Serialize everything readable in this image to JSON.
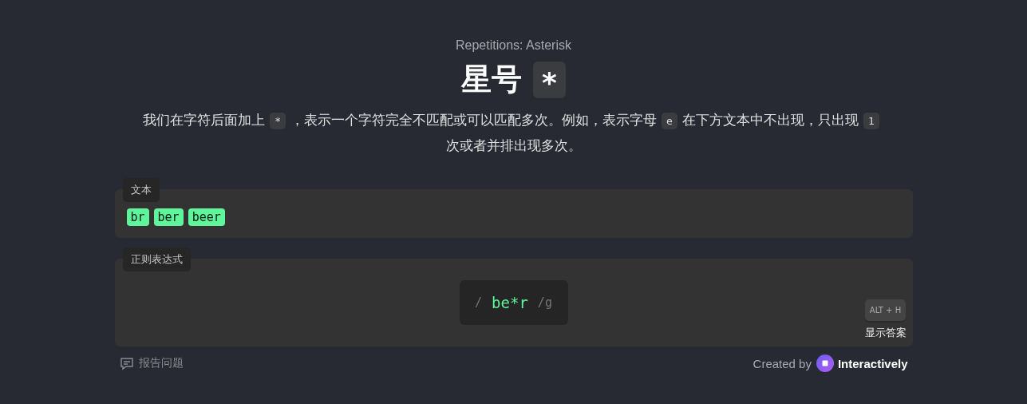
{
  "subtitle": "Repetitions: Asterisk",
  "heading": {
    "text": "星号",
    "symbol": "*"
  },
  "description": [
    {
      "kind": "text",
      "text": "我们在字符后面加上"
    },
    {
      "kind": "code",
      "text": "*"
    },
    {
      "kind": "text",
      "text": "，表示一个字符完全不匹配或可以匹配多次。例如，表示字母"
    },
    {
      "kind": "code",
      "text": "e"
    },
    {
      "kind": "text",
      "text": "在下方文本中不出现，"
    },
    {
      "kind": "text",
      "text": "只出现"
    },
    {
      "kind": "code",
      "text": "1"
    },
    {
      "kind": "text",
      "text": "次或者并排出现多次。"
    }
  ],
  "text_panel": {
    "label": "文本",
    "words": [
      {
        "text": "br",
        "matched": true
      },
      {
        "text": "ber",
        "matched": true
      },
      {
        "text": "beer",
        "matched": true
      }
    ]
  },
  "regex_panel": {
    "label": "正则表达式",
    "open": "/",
    "pattern": "be*r",
    "flags": "/g",
    "shortcut": "ALT + H",
    "answer_button": "显示答案"
  },
  "footer": {
    "report": "报告问题",
    "created_by": "Created by",
    "brand": "Interactively"
  }
}
